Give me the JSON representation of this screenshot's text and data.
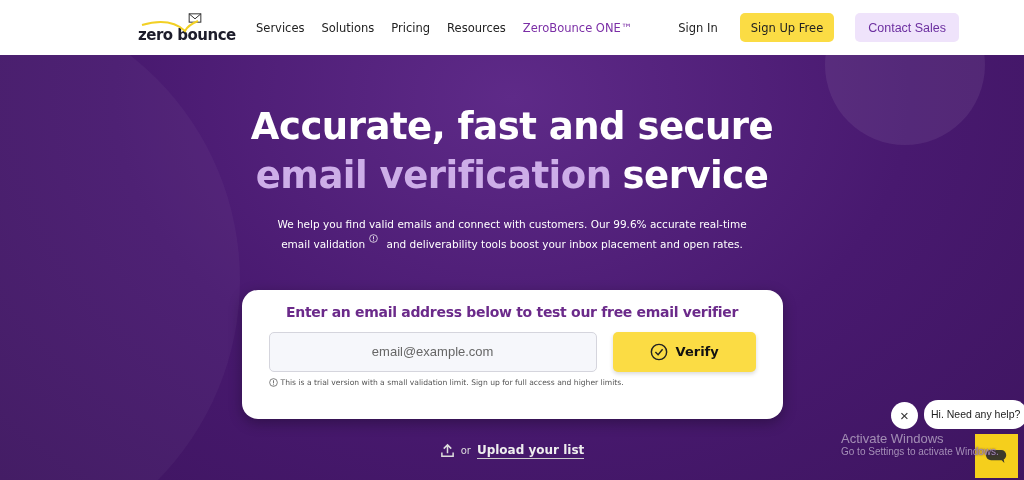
{
  "header": {
    "logo": "zero bounce",
    "nav": [
      {
        "label": "Services",
        "highlighted": false
      },
      {
        "label": "Solutions",
        "highlighted": false
      },
      {
        "label": "Pricing",
        "highlighted": false
      },
      {
        "label": "Resources",
        "highlighted": false
      },
      {
        "label": "ZeroBounce ONE™",
        "highlighted": true
      }
    ],
    "sign_in": "Sign In",
    "sign_up": "Sign Up Free",
    "contact": "Contact Sales"
  },
  "hero": {
    "headline_line_1": "Accurate, fast and secure",
    "headline_accent": "email verification",
    "headline_rest": "service",
    "description_before": "We help you find valid emails and connect with customers. Our 99.6% accurate real-time",
    "description_link": "email validation",
    "description_after": "and deliverability tools boost your inbox placement and open rates."
  },
  "verifier": {
    "title": "Enter an email address below to test our free email verifier",
    "placeholder": "email@example.com",
    "button": "Verify",
    "note": "This is a trial version with a small validation limit. Sign up for full access and higher limits."
  },
  "upload": {
    "prefix": "or",
    "link": "Upload your list"
  },
  "chat": {
    "greeting": "Hi. Need any help?",
    "close": "×"
  },
  "os_notice": {
    "title": "Activate Windows",
    "text": "Go to Settings to activate Windows."
  }
}
